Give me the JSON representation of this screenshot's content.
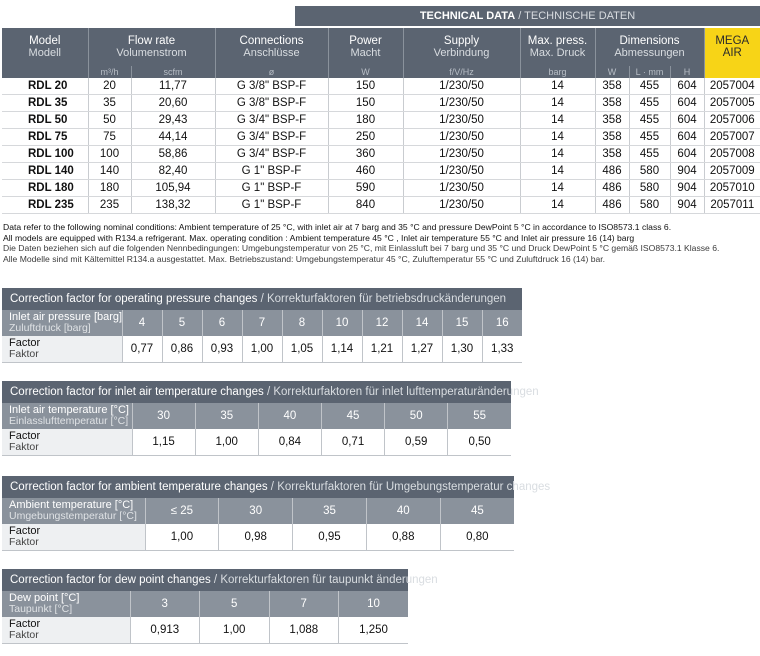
{
  "tech": {
    "title_en": "TECHNICAL DATA",
    "title_sep": " / ",
    "title_de": "TECHNISCHE DATEN",
    "headers": {
      "model": {
        "en": "Model",
        "de": "Modell"
      },
      "flow": {
        "en": "Flow rate",
        "de": "Volumenstrom"
      },
      "connections": {
        "en": "Connections",
        "de": "Anschlüsse"
      },
      "power": {
        "en": "Power",
        "de": "Macht"
      },
      "supply": {
        "en": "Supply",
        "de": "Verbindung"
      },
      "press": {
        "en": "Max. press.",
        "de": "Max. Druck"
      },
      "dims": {
        "en": "Dimensions",
        "de": "Abmessungen"
      },
      "brand": {
        "line1": "MEGA",
        "line2": "AIR"
      }
    },
    "units": {
      "flow_m3h": "m³/h",
      "flow_scfm": "scfm",
      "conn": "ø",
      "power": "W",
      "supply": "f/V/Hz",
      "press": "barg",
      "dim_w": "W",
      "dim_l": "L",
      "dim_h": "H",
      "dim_unit": "mm"
    },
    "rows": [
      {
        "model": "RDL 20",
        "m3h": "20",
        "scfm": "11,77",
        "conn": "G 3/8\" BSP-F",
        "power": "150",
        "supply": "1/230/50",
        "press": "14",
        "w": "358",
        "l": "455",
        "h": "604",
        "code": "2057004"
      },
      {
        "model": "RDL 35",
        "m3h": "35",
        "scfm": "20,60",
        "conn": "G 3/8\" BSP-F",
        "power": "150",
        "supply": "1/230/50",
        "press": "14",
        "w": "358",
        "l": "455",
        "h": "604",
        "code": "2057005"
      },
      {
        "model": "RDL 50",
        "m3h": "50",
        "scfm": "29,43",
        "conn": "G 3/4\" BSP-F",
        "power": "180",
        "supply": "1/230/50",
        "press": "14",
        "w": "358",
        "l": "455",
        "h": "604",
        "code": "2057006"
      },
      {
        "model": "RDL 75",
        "m3h": "75",
        "scfm": "44,14",
        "conn": "G 3/4\" BSP-F",
        "power": "250",
        "supply": "1/230/50",
        "press": "14",
        "w": "358",
        "l": "455",
        "h": "604",
        "code": "2057007"
      },
      {
        "model": "RDL 100",
        "m3h": "100",
        "scfm": "58,86",
        "conn": "G 3/4\" BSP-F",
        "power": "360",
        "supply": "1/230/50",
        "press": "14",
        "w": "358",
        "l": "455",
        "h": "604",
        "code": "2057008"
      },
      {
        "model": "RDL 140",
        "m3h": "140",
        "scfm": "82,40",
        "conn": "G 1\" BSP-F",
        "power": "460",
        "supply": "1/230/50",
        "press": "14",
        "w": "486",
        "l": "580",
        "h": "904",
        "code": "2057009"
      },
      {
        "model": "RDL 180",
        "m3h": "180",
        "scfm": "105,94",
        "conn": "G 1\" BSP-F",
        "power": "590",
        "supply": "1/230/50",
        "press": "14",
        "w": "486",
        "l": "580",
        "h": "904",
        "code": "2057010"
      },
      {
        "model": "RDL 235",
        "m3h": "235",
        "scfm": "138,32",
        "conn": "G 1\" BSP-F",
        "power": "840",
        "supply": "1/230/50",
        "press": "14",
        "w": "486",
        "l": "580",
        "h": "904",
        "code": "2057011"
      }
    ]
  },
  "notes": {
    "en1": "Data refer to the following nominal conditions: Ambient temperature of 25 °C, with inlet air at 7 barg and 35 °C and pressure DewPoint 5 °C in accordance to ISO8573.1 class 6.",
    "en2": "All models are equipped with R134.a refrigerant. Max. operating condition : Ambient temperature 45 °C , Inlet air temperature 55 °C and Inlet air pressure 16 (14) barg",
    "de1": "Die Daten beziehen sich auf die folgenden Nennbedingungen: Umgebungstemperatur von 25 °C, mit Einlassluft bei 7 barg und 35 °C und Druck DewPoint 5 °C gemäß ISO8573.1 Klasse 6.",
    "de2": "Alle Modelle sind mit Kältemittel R134.a ausgestattet. Max. Betriebszustand: Umgebungstemperatur 45 °C, Zuluftemperatur 55 °C und Zuluftdruck 16 (14) bar."
  },
  "cf_pressure": {
    "title_en": "Correction factor for operating pressure changes",
    "title_sep": " / ",
    "title_de": "Korrekturfaktoren für betriebsdruckänderungen",
    "label_en": "Inlet air pressure [barg]",
    "label_de": "Zuluftdruck [barg]",
    "factor_en": "Factor",
    "factor_de": "Faktor",
    "headers": [
      "4",
      "5",
      "6",
      "7",
      "8",
      "10",
      "12",
      "14",
      "15",
      "16"
    ],
    "values": [
      "0,77",
      "0,86",
      "0,93",
      "1,00",
      "1,05",
      "1,14",
      "1,21",
      "1,27",
      "1,30",
      "1,33"
    ]
  },
  "cf_inlet": {
    "title_en": "Correction factor for inlet air temperature changes",
    "title_sep": " / ",
    "title_de": "Korrekturfaktoren für inlet lufttemperaturänderungen",
    "label_en": "Inlet air temperature [°C]",
    "label_de": "Einlasslufttemperatur [°C]",
    "factor_en": "Factor",
    "factor_de": "Faktor",
    "headers": [
      "30",
      "35",
      "40",
      "45",
      "50",
      "55"
    ],
    "values": [
      "1,15",
      "1,00",
      "0,84",
      "0,71",
      "0,59",
      "0,50"
    ]
  },
  "cf_ambient": {
    "title_en": "Correction factor for ambient temperature changes",
    "title_sep": " / ",
    "title_de": "Korrekturfaktoren für Umgebungstemperatur changes",
    "label_en": "Ambient temperature [°C]",
    "label_de": "Umgebungstemperatur [°C]",
    "factor_en": "Factor",
    "factor_de": "Faktor",
    "headers": [
      "≤ 25",
      "30",
      "35",
      "40",
      "45"
    ],
    "values": [
      "1,00",
      "0,98",
      "0,95",
      "0,88",
      "0,80"
    ]
  },
  "cf_dew": {
    "title_en": "Correction factor for dew point changes",
    "title_sep": " / ",
    "title_de": "Korrekturfaktoren für taupunkt änderungen",
    "label_en": "Dew point [°C]",
    "label_de": "Taupunkt [°C]",
    "factor_en": "Factor",
    "factor_de": "Faktor",
    "headers": [
      "3",
      "5",
      "7",
      "10"
    ],
    "values": [
      "0,913",
      "1,00",
      "1,088",
      "1,250"
    ]
  },
  "colors": {
    "header_bg": "#5b6471",
    "subheader_bg": "#8a929c",
    "brand_yellow": "#f7d417"
  }
}
